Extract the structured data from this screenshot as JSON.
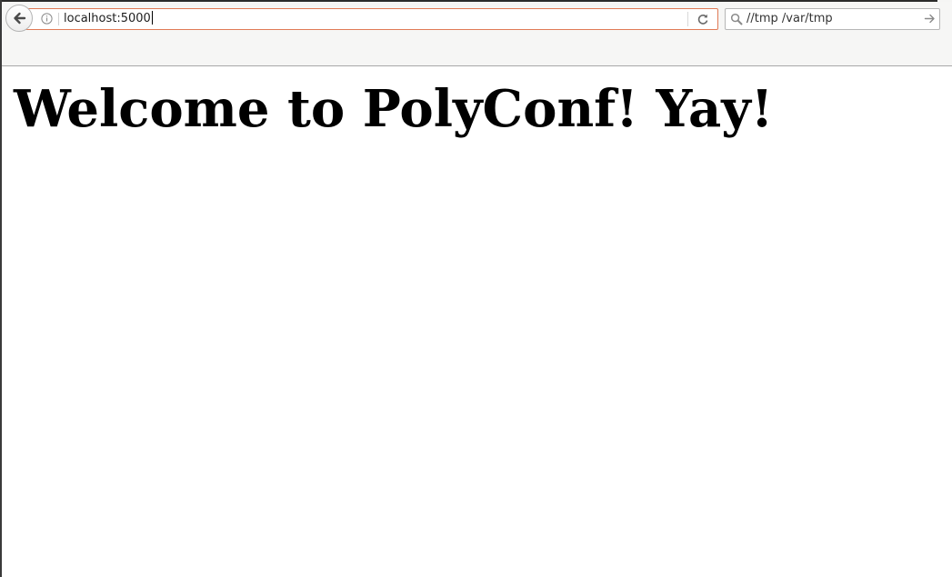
{
  "browser": {
    "url": "localhost:5000",
    "search_value": "//tmp /var/tmp"
  },
  "icons": {
    "back": "back-arrow-icon",
    "info": "info-icon",
    "reload": "reload-icon",
    "search": "search-icon",
    "go": "go-arrow-icon"
  },
  "colors": {
    "url_bar_focus_border": "#e07a56",
    "toolbar_background": "#f6f6f5"
  },
  "page": {
    "heading": "Welcome to PolyConf! Yay!"
  }
}
